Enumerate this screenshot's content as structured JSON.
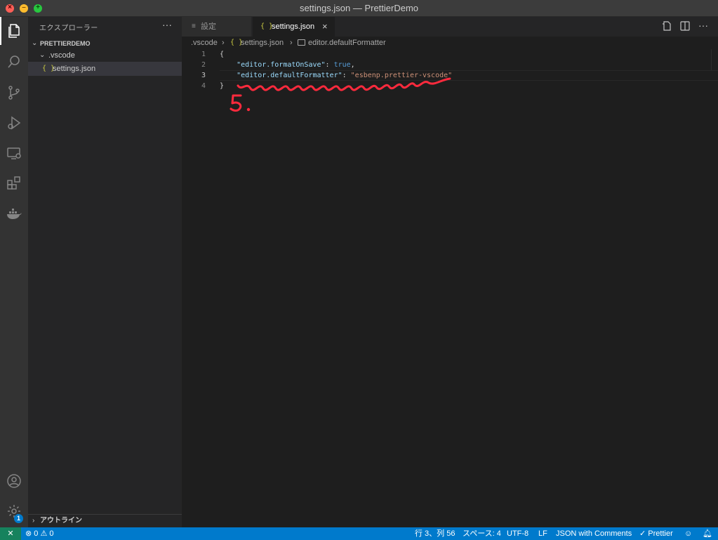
{
  "window": {
    "title": "settings.json — PrettierDemo"
  },
  "activity_bar": {
    "items": [
      "explorer-icon",
      "search-icon",
      "source-control-icon",
      "run-debug-icon",
      "remote-explorer-icon",
      "extensions-icon",
      "docker-icon"
    ],
    "bottom_items": [
      "account-icon",
      "manage-gear-icon"
    ],
    "manage_badge": "1"
  },
  "sidebar": {
    "title": "エクスプローラー",
    "more_label": "···",
    "root_folder": "PRETTIERDEMO",
    "tree": [
      {
        "label": ".vscode",
        "type": "folder",
        "expanded": true
      },
      {
        "label": "settings.json",
        "type": "file",
        "selected": true,
        "icon_glyph": "{ }"
      }
    ],
    "outline_label": "アウトライン"
  },
  "tabs": [
    {
      "label": "設定",
      "active": false
    },
    {
      "label": "settings.json",
      "active": true,
      "icon_glyph": "{ }",
      "close_glyph": "×"
    }
  ],
  "breadcrumbs": [
    ".vscode",
    "settings.json",
    "editor.defaultFormatter"
  ],
  "editor": {
    "current_line": 3,
    "lines": [
      {
        "number": "1",
        "tokens": [
          {
            "t": "p",
            "v": "{"
          }
        ]
      },
      {
        "number": "2",
        "tokens": [
          {
            "t": "p",
            "v": "    "
          },
          {
            "t": "k",
            "v": "\"editor.formatOnSave\""
          },
          {
            "t": "p",
            "v": ": "
          },
          {
            "t": "b",
            "v": "true"
          },
          {
            "t": "p",
            "v": ","
          }
        ]
      },
      {
        "number": "3",
        "tokens": [
          {
            "t": "p",
            "v": "    "
          },
          {
            "t": "k",
            "v": "\"editor.defaultFormatter\""
          },
          {
            "t": "p",
            "v": ": "
          },
          {
            "t": "s",
            "v": "\"esbenp.prettier-vscode\""
          }
        ]
      },
      {
        "number": "4",
        "tokens": [
          {
            "t": "p",
            "v": "}"
          }
        ]
      }
    ],
    "annotation": {
      "text": "5.",
      "color": "#ff2a3d"
    }
  },
  "status_bar": {
    "errors": "0",
    "warnings": "0",
    "position": "行 3、列 56",
    "indent": "スペース: 4",
    "encoding": "UTF-8",
    "eol": "LF",
    "language": "JSON with Comments",
    "formatter": "Prettier"
  },
  "colors": {
    "status_bar": "#007acc",
    "remote_indicator": "#16825d",
    "annotation_red": "#ff2a3d"
  }
}
